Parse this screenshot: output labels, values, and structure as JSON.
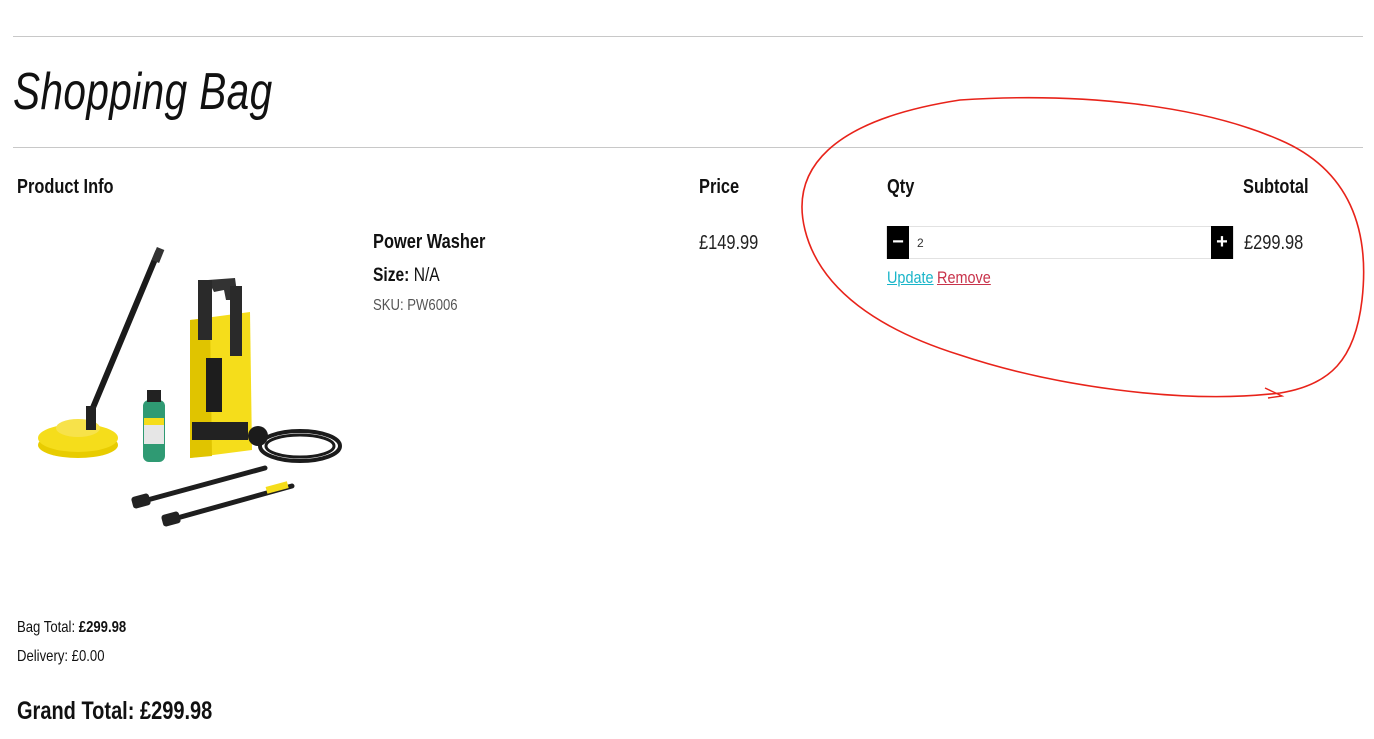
{
  "page": {
    "title": "Shopping Bag"
  },
  "table_headers": {
    "product_info": "Product Info",
    "price": "Price",
    "qty": "Qty",
    "subtotal": "Subtotal"
  },
  "item": {
    "name": "Power Washer",
    "size_label": "Size:",
    "size_value": "N/A",
    "sku": "SKU: PW6006",
    "price": "£149.99",
    "quantity": "2",
    "subtotal": "£299.98",
    "minus_symbol": "−",
    "plus_symbol": "+",
    "update_label": "Update",
    "remove_label": "Remove"
  },
  "totals": {
    "bag_total_label": "Bag Total:",
    "bag_total_value": "£299.98",
    "delivery_label": "Delivery:",
    "delivery_value": "£0.00",
    "grand_total_label": "Grand Total:",
    "grand_total_value": "£299.98"
  },
  "colors": {
    "update_link": "#19b5c9",
    "remove_link": "#c8324a",
    "annotation": "#e8231a",
    "product_yellow": "#f5dd1b"
  }
}
